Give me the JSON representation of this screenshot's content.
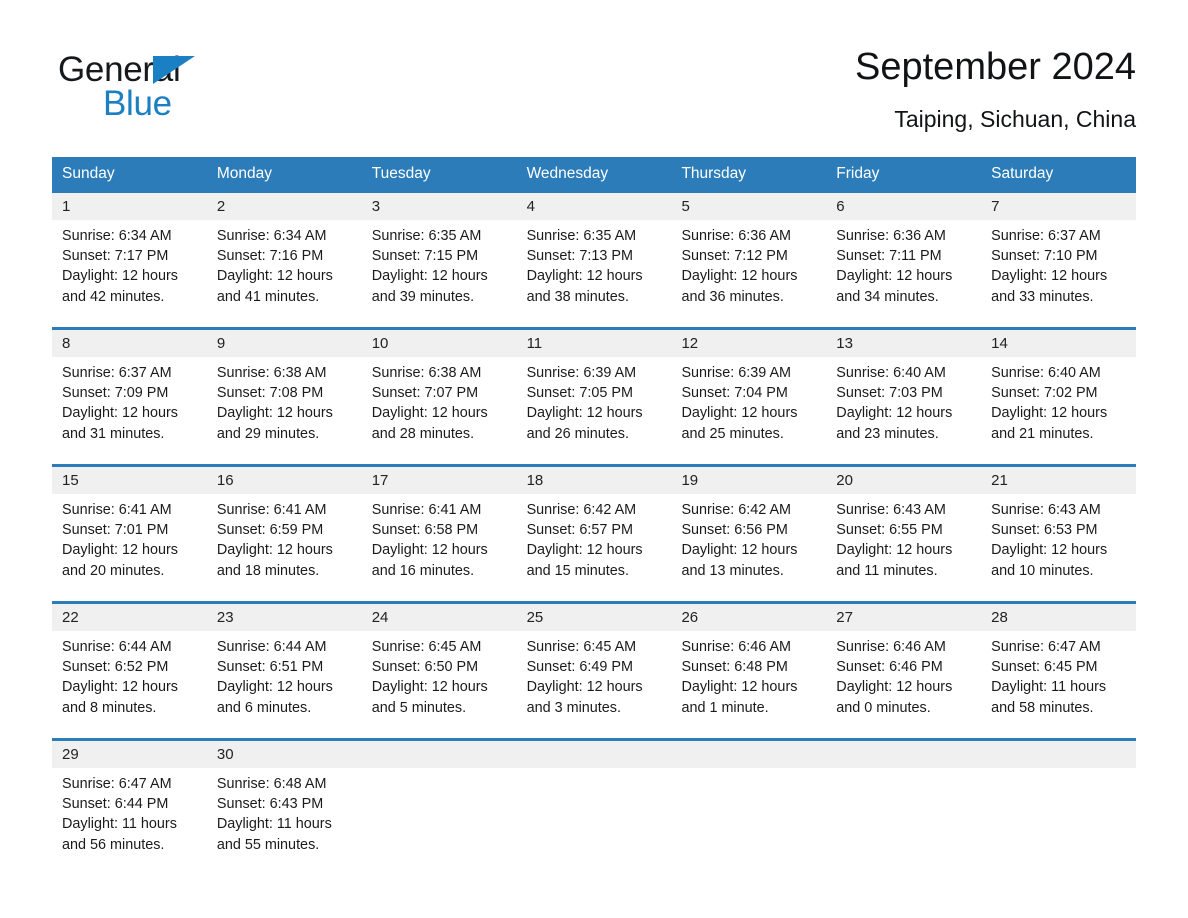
{
  "brand": {
    "name_part1": "General",
    "name_part2": "Blue",
    "accent_color": "#1b7fc4"
  },
  "header": {
    "title": "September 2024",
    "subtitle": "Taiping, Sichuan, China",
    "header_bg": "#2b7cb9",
    "daynum_bg": "#f0f0f0"
  },
  "weekdays": [
    "Sunday",
    "Monday",
    "Tuesday",
    "Wednesday",
    "Thursday",
    "Friday",
    "Saturday"
  ],
  "weeks": [
    {
      "days": [
        {
          "num": "1",
          "sunrise": "Sunrise: 6:34 AM",
          "sunset": "Sunset: 7:17 PM",
          "daylight": "Daylight: 12 hours and 42 minutes."
        },
        {
          "num": "2",
          "sunrise": "Sunrise: 6:34 AM",
          "sunset": "Sunset: 7:16 PM",
          "daylight": "Daylight: 12 hours and 41 minutes."
        },
        {
          "num": "3",
          "sunrise": "Sunrise: 6:35 AM",
          "sunset": "Sunset: 7:15 PM",
          "daylight": "Daylight: 12 hours and 39 minutes."
        },
        {
          "num": "4",
          "sunrise": "Sunrise: 6:35 AM",
          "sunset": "Sunset: 7:13 PM",
          "daylight": "Daylight: 12 hours and 38 minutes."
        },
        {
          "num": "5",
          "sunrise": "Sunrise: 6:36 AM",
          "sunset": "Sunset: 7:12 PM",
          "daylight": "Daylight: 12 hours and 36 minutes."
        },
        {
          "num": "6",
          "sunrise": "Sunrise: 6:36 AM",
          "sunset": "Sunset: 7:11 PM",
          "daylight": "Daylight: 12 hours and 34 minutes."
        },
        {
          "num": "7",
          "sunrise": "Sunrise: 6:37 AM",
          "sunset": "Sunset: 7:10 PM",
          "daylight": "Daylight: 12 hours and 33 minutes."
        }
      ]
    },
    {
      "days": [
        {
          "num": "8",
          "sunrise": "Sunrise: 6:37 AM",
          "sunset": "Sunset: 7:09 PM",
          "daylight": "Daylight: 12 hours and 31 minutes."
        },
        {
          "num": "9",
          "sunrise": "Sunrise: 6:38 AM",
          "sunset": "Sunset: 7:08 PM",
          "daylight": "Daylight: 12 hours and 29 minutes."
        },
        {
          "num": "10",
          "sunrise": "Sunrise: 6:38 AM",
          "sunset": "Sunset: 7:07 PM",
          "daylight": "Daylight: 12 hours and 28 minutes."
        },
        {
          "num": "11",
          "sunrise": "Sunrise: 6:39 AM",
          "sunset": "Sunset: 7:05 PM",
          "daylight": "Daylight: 12 hours and 26 minutes."
        },
        {
          "num": "12",
          "sunrise": "Sunrise: 6:39 AM",
          "sunset": "Sunset: 7:04 PM",
          "daylight": "Daylight: 12 hours and 25 minutes."
        },
        {
          "num": "13",
          "sunrise": "Sunrise: 6:40 AM",
          "sunset": "Sunset: 7:03 PM",
          "daylight": "Daylight: 12 hours and 23 minutes."
        },
        {
          "num": "14",
          "sunrise": "Sunrise: 6:40 AM",
          "sunset": "Sunset: 7:02 PM",
          "daylight": "Daylight: 12 hours and 21 minutes."
        }
      ]
    },
    {
      "days": [
        {
          "num": "15",
          "sunrise": "Sunrise: 6:41 AM",
          "sunset": "Sunset: 7:01 PM",
          "daylight": "Daylight: 12 hours and 20 minutes."
        },
        {
          "num": "16",
          "sunrise": "Sunrise: 6:41 AM",
          "sunset": "Sunset: 6:59 PM",
          "daylight": "Daylight: 12 hours and 18 minutes."
        },
        {
          "num": "17",
          "sunrise": "Sunrise: 6:41 AM",
          "sunset": "Sunset: 6:58 PM",
          "daylight": "Daylight: 12 hours and 16 minutes."
        },
        {
          "num": "18",
          "sunrise": "Sunrise: 6:42 AM",
          "sunset": "Sunset: 6:57 PM",
          "daylight": "Daylight: 12 hours and 15 minutes."
        },
        {
          "num": "19",
          "sunrise": "Sunrise: 6:42 AM",
          "sunset": "Sunset: 6:56 PM",
          "daylight": "Daylight: 12 hours and 13 minutes."
        },
        {
          "num": "20",
          "sunrise": "Sunrise: 6:43 AM",
          "sunset": "Sunset: 6:55 PM",
          "daylight": "Daylight: 12 hours and 11 minutes."
        },
        {
          "num": "21",
          "sunrise": "Sunrise: 6:43 AM",
          "sunset": "Sunset: 6:53 PM",
          "daylight": "Daylight: 12 hours and 10 minutes."
        }
      ]
    },
    {
      "days": [
        {
          "num": "22",
          "sunrise": "Sunrise: 6:44 AM",
          "sunset": "Sunset: 6:52 PM",
          "daylight": "Daylight: 12 hours and 8 minutes."
        },
        {
          "num": "23",
          "sunrise": "Sunrise: 6:44 AM",
          "sunset": "Sunset: 6:51 PM",
          "daylight": "Daylight: 12 hours and 6 minutes."
        },
        {
          "num": "24",
          "sunrise": "Sunrise: 6:45 AM",
          "sunset": "Sunset: 6:50 PM",
          "daylight": "Daylight: 12 hours and 5 minutes."
        },
        {
          "num": "25",
          "sunrise": "Sunrise: 6:45 AM",
          "sunset": "Sunset: 6:49 PM",
          "daylight": "Daylight: 12 hours and 3 minutes."
        },
        {
          "num": "26",
          "sunrise": "Sunrise: 6:46 AM",
          "sunset": "Sunset: 6:48 PM",
          "daylight": "Daylight: 12 hours and 1 minute."
        },
        {
          "num": "27",
          "sunrise": "Sunrise: 6:46 AM",
          "sunset": "Sunset: 6:46 PM",
          "daylight": "Daylight: 12 hours and 0 minutes."
        },
        {
          "num": "28",
          "sunrise": "Sunrise: 6:47 AM",
          "sunset": "Sunset: 6:45 PM",
          "daylight": "Daylight: 11 hours and 58 minutes."
        }
      ]
    },
    {
      "days": [
        {
          "num": "29",
          "sunrise": "Sunrise: 6:47 AM",
          "sunset": "Sunset: 6:44 PM",
          "daylight": "Daylight: 11 hours and 56 minutes."
        },
        {
          "num": "30",
          "sunrise": "Sunrise: 6:48 AM",
          "sunset": "Sunset: 6:43 PM",
          "daylight": "Daylight: 11 hours and 55 minutes."
        },
        {
          "num": "",
          "sunrise": "",
          "sunset": "",
          "daylight": ""
        },
        {
          "num": "",
          "sunrise": "",
          "sunset": "",
          "daylight": ""
        },
        {
          "num": "",
          "sunrise": "",
          "sunset": "",
          "daylight": ""
        },
        {
          "num": "",
          "sunrise": "",
          "sunset": "",
          "daylight": ""
        },
        {
          "num": "",
          "sunrise": "",
          "sunset": "",
          "daylight": ""
        }
      ]
    }
  ]
}
